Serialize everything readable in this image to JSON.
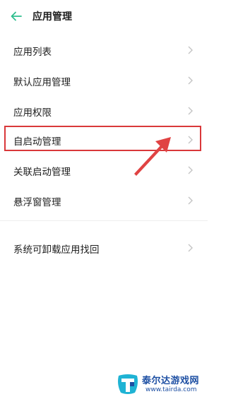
{
  "header": {
    "title": "应用管理",
    "back_icon": "arrow-left-icon",
    "accent_color": "#2fbf8e"
  },
  "menu": {
    "items": [
      {
        "label": "应用列表"
      },
      {
        "label": "默认应用管理"
      },
      {
        "label": "应用权限"
      },
      {
        "label": "自启动管理"
      },
      {
        "label": "关联启动管理"
      },
      {
        "label": "悬浮窗管理"
      },
      {
        "label": "系统可卸载应用找回"
      }
    ],
    "chevron_icon": "chevron-right-icon",
    "highlighted_item": "自启动管理",
    "highlight_color": "#d9383a"
  },
  "watermark": {
    "name": "泰尔达游戏网",
    "url": "www.tairda.com"
  }
}
